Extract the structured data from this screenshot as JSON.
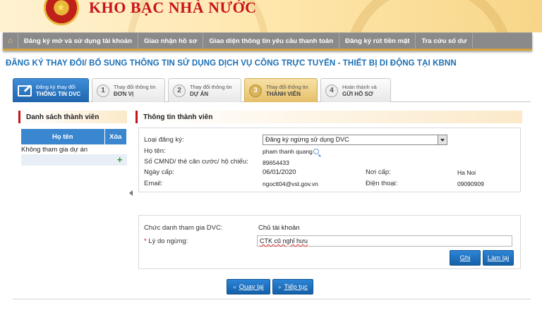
{
  "header": {
    "brand": "KHO BẠC NHÀ NƯỚC"
  },
  "nav": {
    "home_icon": "home-icon",
    "items": [
      "Đăng ký mở và sử dụng tài khoản",
      "Giao nhận hồ sơ",
      "Giao diện thông tin yêu cầu thanh toán",
      "Đăng ký rút tiền mặt",
      "Tra cứu số dư"
    ]
  },
  "page_title": "ĐĂNG KÝ THAY ĐỔI/ BỔ SUNG THÔNG TIN SỬ DỤNG DỊCH VỤ CÔNG TRỰC TUYẾN - THIẾT BỊ DI ĐỘNG TẠI KBNN",
  "steps": [
    {
      "num": "",
      "line1": "Đăng ký thay đổi",
      "line2": "THÔNG TIN DVC"
    },
    {
      "num": "1",
      "line1": "Thay đổi thông tin",
      "line2": "ĐƠN VỊ"
    },
    {
      "num": "2",
      "line1": "Thay đổi thông tin",
      "line2": "DỰ ÁN"
    },
    {
      "num": "3",
      "line1": "Thay đổi thông tin",
      "line2": "THÀNH VIÊN"
    },
    {
      "num": "4",
      "line1": "Hoàn thành và",
      "line2": "GỬI HỒ SƠ"
    }
  ],
  "members": {
    "title": "Danh sách thành viên",
    "col_name": "Họ tên",
    "col_delete": "Xóa",
    "rows": [
      "Không tham gia dự án"
    ]
  },
  "info": {
    "title": "Thông tin thành viên",
    "type_label": "Loại đăng ký:",
    "type_value": "Đăng ký ngừng sử dụng DVC",
    "name_label": "Họ tên:",
    "name_value": "pham thanh quang",
    "id_label": "Số CMND/ thẻ căn cước/ hộ chiếu:",
    "id_value": "89654433",
    "issue_date_label": "Ngày cấp:",
    "issue_date_value": "06/01/2020",
    "issue_place_label": "Nơi cấp:",
    "issue_place_value": "Ha Noi",
    "email_label": "Email:",
    "email_value": "ngoctt04@vst.gov.vn",
    "phone_label": "Điện thoại:",
    "phone_value": "09090909"
  },
  "reason": {
    "role_label": "Chức danh tham gia DVC:",
    "role_value": "Chủ tài khoản",
    "required_mark": "*",
    "reason_label": "Lý do ngừng:",
    "reason_value": "CTK cũ nghỉ hưu",
    "save_label": "Ghi",
    "reset_label": "Làm lại"
  },
  "footer": {
    "back_label": "Quay lại",
    "next_label": "Tiếp tục"
  },
  "colors": {
    "brand_red": "#c8141a",
    "accent_blue": "#1a6fb5",
    "nav_gray": "#8a8a8a",
    "gold": "#d8a23a"
  }
}
